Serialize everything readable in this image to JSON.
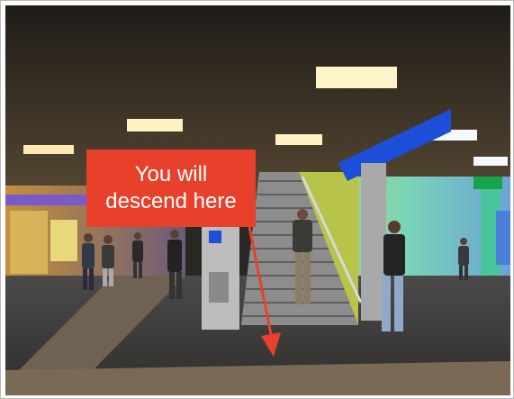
{
  "callout": {
    "line1": "You will",
    "line2": "descend here"
  },
  "colors": {
    "callout_bg": "#e8412b",
    "arrow": "#e8412b",
    "ceiling": "#3a342c",
    "floor": "#3b3a3a",
    "signage_blue": "#1d4ed8",
    "exit_green": "#16a34a"
  }
}
